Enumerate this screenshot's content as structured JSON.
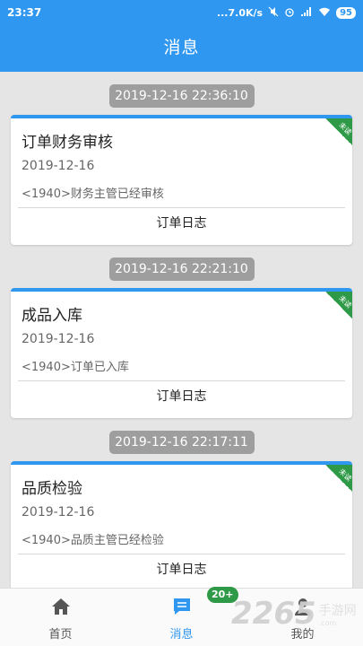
{
  "status_bar": {
    "time": "23:37",
    "network_speed": "...7.0K/s",
    "battery": "95"
  },
  "header": {
    "title": "消息"
  },
  "colors": {
    "accent": "#2f97f0",
    "ribbon": "#2e9a47",
    "pill": "#9e9e9e"
  },
  "messages": [
    {
      "time": "2019-12-16 22:36:10",
      "title": "订单财务审核",
      "date": "2019-12-16",
      "desc": "<1940>财务主管已经审核",
      "link": "订单日志",
      "ribbon": "未读"
    },
    {
      "time": "2019-12-16 22:21:10",
      "title": "成品入库",
      "date": "2019-12-16",
      "desc": "<1940>订单已入库",
      "link": "订单日志",
      "ribbon": "未读"
    },
    {
      "time": "2019-12-16 22:17:11",
      "title": "品质检验",
      "date": "2019-12-16",
      "desc": "<1940>品质主管已经检验",
      "link": "订单日志",
      "ribbon": "未读"
    }
  ],
  "bottom_nav": {
    "items": [
      {
        "label": "首页",
        "icon": "home-icon"
      },
      {
        "label": "消息",
        "icon": "message-icon",
        "badge": "20+"
      },
      {
        "label": "我的",
        "icon": "person-icon"
      }
    ]
  },
  "watermark": {
    "number": "2265",
    "text": "手游网",
    "sub": ".com"
  }
}
